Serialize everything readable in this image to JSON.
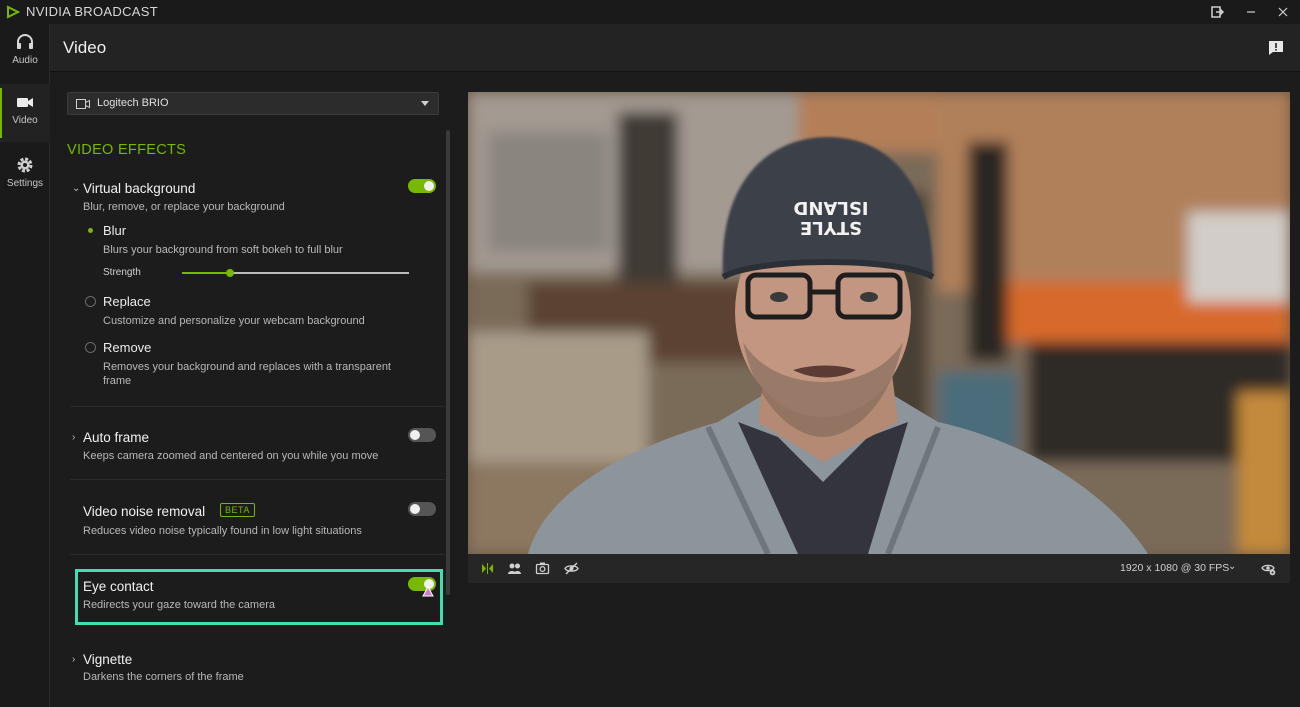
{
  "app": {
    "title": "NVIDIA BROADCAST"
  },
  "nav": {
    "items": [
      {
        "label": "Audio",
        "icon": "headphones-icon"
      },
      {
        "label": "Video",
        "icon": "camera-icon",
        "active": true
      },
      {
        "label": "Settings",
        "icon": "gear-icon"
      }
    ]
  },
  "header": {
    "title": "Video"
  },
  "device": {
    "selected": "Logitech BRIO"
  },
  "effects_section": {
    "title": "VIDEO EFFECTS"
  },
  "effects": {
    "virtual_background": {
      "title": "Virtual background",
      "desc": "Blur, remove, or replace your background",
      "enabled": true,
      "options": [
        {
          "title": "Blur",
          "desc": "Blurs your background from soft bokeh to full blur",
          "checked": true
        },
        {
          "title": "Replace",
          "desc": "Customize and personalize your webcam background",
          "checked": false
        },
        {
          "title": "Remove",
          "desc": "Removes your background and replaces with a transparent frame",
          "checked": false
        }
      ],
      "strength": {
        "label": "Strength",
        "value": 0.21
      }
    },
    "auto_frame": {
      "title": "Auto frame",
      "desc": "Keeps camera zoomed and centered on you while you move",
      "enabled": false
    },
    "noise_removal": {
      "title": "Video noise removal",
      "badge": "BETA",
      "desc": "Reduces video noise typically found in low light situations",
      "enabled": false
    },
    "eye_contact": {
      "title": "Eye contact",
      "desc": "Redirects your gaze toward the camera",
      "enabled": true
    },
    "vignette": {
      "title": "Vignette",
      "desc": "Darkens the corners of the frame"
    }
  },
  "preview": {
    "resolution": "1920 x 1080 @ 30 FPS",
    "beanie_text": [
      "ISLAND",
      "STYLE"
    ]
  },
  "colors": {
    "accent": "#76b900",
    "highlight": "#3ee0b0"
  }
}
